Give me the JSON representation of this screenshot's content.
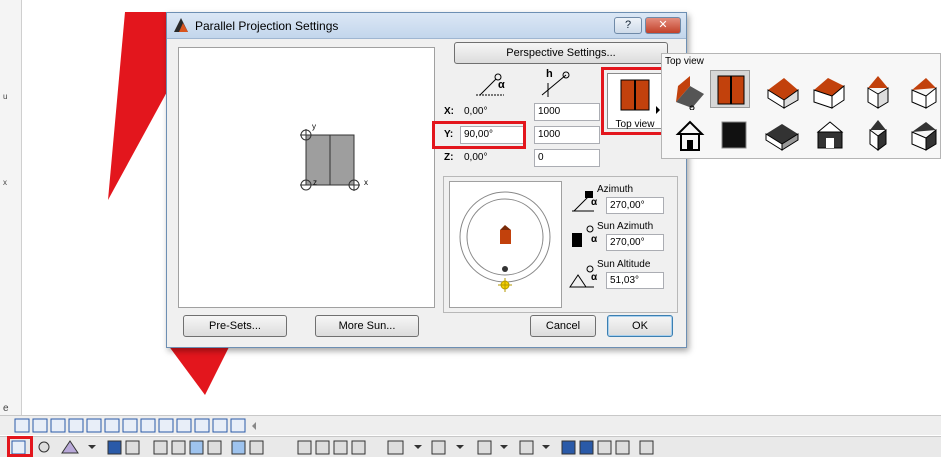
{
  "dialog": {
    "title": "Parallel Projection Settings",
    "help_label": "?",
    "close_label": "✕",
    "perspective_button": "Perspective Settings...",
    "presets_button": "Pre-Sets...",
    "more_sun_button": "More Sun...",
    "cancel_button": "Cancel",
    "ok_button": "OK"
  },
  "preview": {
    "axis_y": "y",
    "axis_x": "x",
    "axis_z": "z"
  },
  "coords": {
    "x_label": "X:",
    "x_angle": "0,00°",
    "x_value": "1000",
    "y_label": "Y:",
    "y_angle": "90,00°",
    "y_value": "1000",
    "z_label": "Z:",
    "z_angle": "0,00°",
    "z_value": "0",
    "alpha": "α",
    "h": "h"
  },
  "sun": {
    "azimuth_label": "Azimuth",
    "azimuth_value": "270,00°",
    "sun_azimuth_label": "Sun Azimuth",
    "sun_azimuth_value": "270,00°",
    "sun_altitude_label": "Sun Altitude",
    "sun_altitude_value": "51,03°"
  },
  "view_selector": {
    "label": "Top view"
  },
  "palette": {
    "title": "Top view"
  },
  "colors": {
    "highlight": "#e3161d",
    "roof": "#c2410c",
    "wall": "#ffffff",
    "plan_fill": "#9e9e9e"
  },
  "left_ruler": [
    "u",
    "x",
    "e"
  ]
}
